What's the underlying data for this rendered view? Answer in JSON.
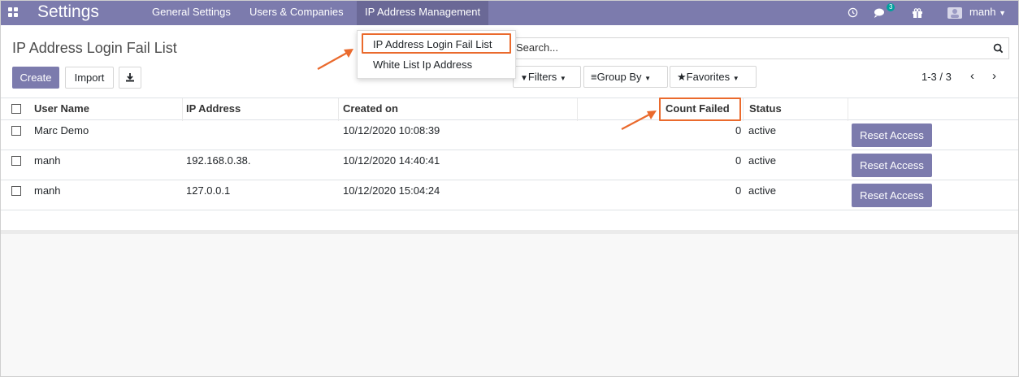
{
  "navbar": {
    "brand": "Settings",
    "menu": [
      "General Settings",
      "Users & Companies",
      "IP Address Management"
    ],
    "messages_count": "3",
    "user": "manh",
    "colors": {
      "navbar": "#7c7bad",
      "active": "#6a6896",
      "badge": "#00a09d"
    }
  },
  "dropdown": {
    "items": [
      "IP Address Login Fail List",
      "White List Ip Address"
    ]
  },
  "control_panel": {
    "title": "IP Address Login Fail List",
    "create_label": "Create",
    "import_label": "Import",
    "search_placeholder": "Search...",
    "filters_label": "Filters",
    "groupby_label": "Group By",
    "favorites_label": "Favorites",
    "pager": "1-3 / 3"
  },
  "table": {
    "headers": [
      "User Name",
      "IP Address",
      "Created on",
      "Count Failed",
      "Status"
    ],
    "rows": [
      {
        "user": "Marc Demo",
        "ip": "",
        "created": "10/12/2020 10:08:39",
        "count": "0",
        "status": "active",
        "action": "Reset Access"
      },
      {
        "user": "manh",
        "ip": "192.168.0.38.",
        "created": "10/12/2020 14:40:41",
        "count": "0",
        "status": "active",
        "action": "Reset Access"
      },
      {
        "user": "manh",
        "ip": "127.0.0.1",
        "created": "10/12/2020 15:04:24",
        "count": "0",
        "status": "active",
        "action": "Reset Access"
      }
    ]
  },
  "annotation_color": "#ea6a2d"
}
